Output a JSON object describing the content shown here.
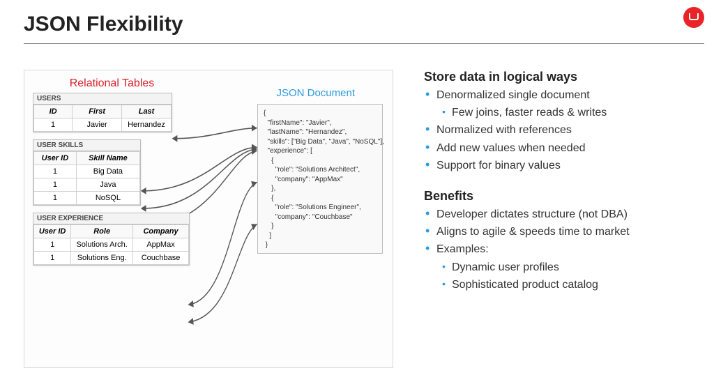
{
  "title": "JSON Flexibility",
  "diagram": {
    "relational_title": "Relational Tables",
    "json_title": "JSON Document",
    "users": {
      "caption": "USERS",
      "headers": [
        "ID",
        "First",
        "Last"
      ],
      "rows": [
        [
          "1",
          "Javier",
          "Hernandez"
        ]
      ]
    },
    "skills": {
      "caption": "USER SKILLS",
      "headers": [
        "User ID",
        "Skill Name"
      ],
      "rows": [
        [
          "1",
          "Big Data"
        ],
        [
          "1",
          "Java"
        ],
        [
          "1",
          "NoSQL"
        ]
      ]
    },
    "exp": {
      "caption": "USER EXPERIENCE",
      "headers": [
        "User ID",
        "Role",
        "Company"
      ],
      "rows": [
        [
          "1",
          "Solutions Arch.",
          "AppMax"
        ],
        [
          "1",
          "Solutions Eng.",
          "Couchbase"
        ]
      ]
    },
    "json_text": "{\n  \"firstName\": \"Javier\",\n  \"lastName\": \"Hernandez\",\n  \"skills\": [\"Big Data\", \"Java\", \"NoSQL\"],\n  \"experience\": [\n    {\n      \"role\": \"Solutions Architect\",\n      \"company\": \"AppMax\"\n    },\n    {\n      \"role\": \"Solutions Engineer\",\n      \"company\": \"Couchbase\"\n    }\n   ]\n }"
  },
  "right": {
    "heading1": "Store data in logical ways",
    "list1": {
      "i0": "Denormalized single document",
      "i0s": "Few joins, faster reads & writes",
      "i1": "Normalized with references",
      "i2": "Add new values when needed",
      "i3": "Support for binary values"
    },
    "heading2": "Benefits",
    "list2": {
      "i0": "Developer dictates structure (not DBA)",
      "i1": "Aligns to agile & speeds time to market",
      "i2": "Examples:",
      "i2s0": "Dynamic user profiles",
      "i2s1": "Sophisticated product catalog"
    }
  }
}
